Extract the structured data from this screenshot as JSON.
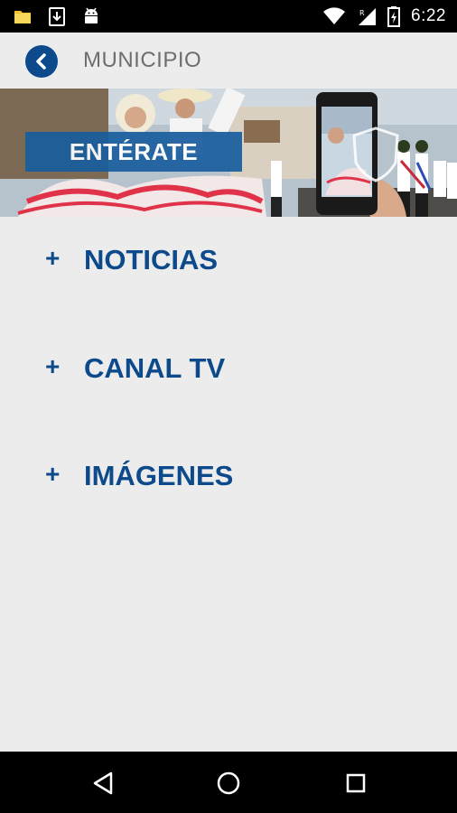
{
  "status_bar": {
    "time": "6:22",
    "icons": [
      "folder-icon",
      "download-icon",
      "android-icon",
      "wifi-icon",
      "signal-icon",
      "battery-icon"
    ]
  },
  "app_bar": {
    "title": "MUNICIPIO",
    "back_icon": "chevron-left-icon"
  },
  "banner": {
    "label": "ENTÉRATE"
  },
  "menu": {
    "items": [
      {
        "icon": "+",
        "label": "NOTICIAS"
      },
      {
        "icon": "+",
        "label": "CANAL TV"
      },
      {
        "icon": "+",
        "label": "IMÁGENES"
      }
    ]
  },
  "nav_bar": {
    "icons": [
      "back-triangle-icon",
      "home-circle-icon",
      "recents-square-icon"
    ]
  },
  "colors": {
    "accent": "#0d4a8c",
    "banner_label_bg": "#1a5e9e",
    "background": "#ececec",
    "title_gray": "#6e6e6e"
  }
}
